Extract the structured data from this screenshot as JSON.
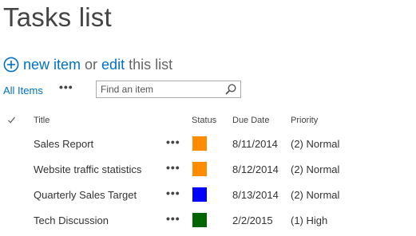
{
  "page": {
    "title": "Tasks list"
  },
  "command": {
    "new_item": "new item",
    "or": "or",
    "edit": "edit",
    "this_list": "this list"
  },
  "view": {
    "current": "All Items",
    "more": "•••"
  },
  "search": {
    "placeholder": "Find an item",
    "value": ""
  },
  "columns": {
    "title": "Title",
    "status": "Status",
    "due_date": "Due Date",
    "priority": "Priority"
  },
  "rows": [
    {
      "title": "Sales Report",
      "menu": "•••",
      "status_color": "#ff8c00",
      "due_date": "8/11/2014",
      "priority": "(2) Normal"
    },
    {
      "title": "Website traffic statistics",
      "menu": "•••",
      "status_color": "#ff8c00",
      "due_date": "8/12/2014",
      "priority": "(2) Normal"
    },
    {
      "title": "Quarterly Sales Target",
      "menu": "•••",
      "status_color": "#0000ff",
      "due_date": "8/13/2014",
      "priority": "(2) Normal"
    },
    {
      "title": "Tech Discussion",
      "menu": "•••",
      "status_color": "#006400",
      "due_date": "2/2/2015",
      "priority": "(1) High"
    }
  ],
  "icons": {
    "new": "plus-circle-icon",
    "search": "magnifier-icon",
    "select_all": "checkmark-icon"
  },
  "colors": {
    "link": "#0072c6",
    "text": "#444444"
  }
}
